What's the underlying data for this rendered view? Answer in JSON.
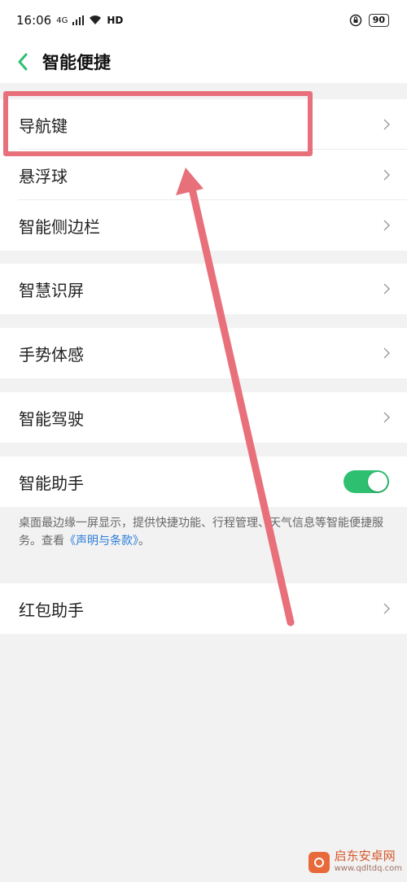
{
  "status_bar": {
    "time": "16:06",
    "signal": "4G",
    "network_badge": "HD",
    "battery": "90"
  },
  "header": {
    "title": "智能便捷"
  },
  "groups": [
    {
      "items": [
        {
          "label": "导航键"
        },
        {
          "label": "悬浮球"
        },
        {
          "label": "智能侧边栏"
        }
      ]
    },
    {
      "items": [
        {
          "label": "智慧识屏"
        }
      ]
    },
    {
      "items": [
        {
          "label": "手势体感"
        }
      ]
    },
    {
      "items": [
        {
          "label": "智能驾驶"
        }
      ]
    },
    {
      "items": [
        {
          "label": "智能助手",
          "toggle": true
        }
      ]
    },
    {
      "items": [
        {
          "label": "红包助手"
        }
      ]
    }
  ],
  "assistant_desc": {
    "text": "桌面最边缘一屏显示，提供快捷功能、行程管理、天气信息等智能便捷服务。查看",
    "link": "《声明与条款》",
    "suffix": "。"
  },
  "watermark": {
    "name": "启东安卓网",
    "site": "www.qdltdq.com"
  },
  "colors": {
    "accent_green": "#2fbf71",
    "highlight_red": "#e8707a",
    "link_blue": "#2a7bd9"
  }
}
